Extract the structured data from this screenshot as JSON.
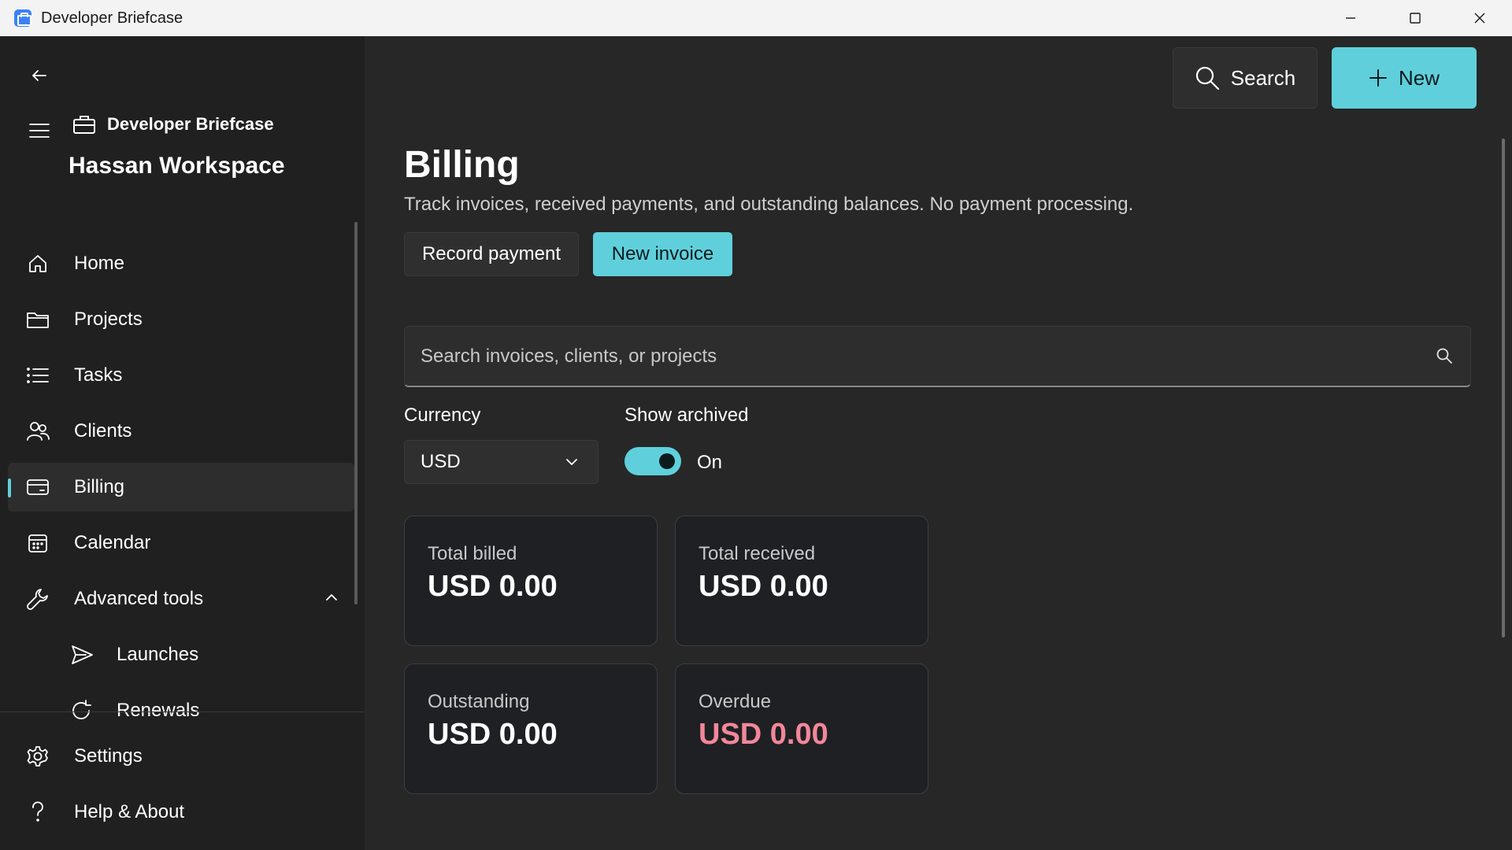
{
  "window": {
    "title": "Developer Briefcase",
    "controls": [
      "minimize-icon",
      "maximize-icon",
      "close-icon"
    ]
  },
  "sidebar": {
    "back_icon": "back-arrow-icon",
    "menu_icon": "hamburger-icon",
    "brand_label": "Developer Briefcase",
    "brand_icon": "briefcase-icon",
    "workspace": "Hassan Workspace",
    "items": [
      {
        "label": "Home",
        "icon": "home-icon"
      },
      {
        "label": "Projects",
        "icon": "folder-icon"
      },
      {
        "label": "Tasks",
        "icon": "list-icon"
      },
      {
        "label": "Clients",
        "icon": "people-icon"
      },
      {
        "label": "Billing",
        "icon": "card-icon",
        "active": true
      },
      {
        "label": "Calendar",
        "icon": "calendar-icon"
      },
      {
        "label": "Advanced tools",
        "icon": "wrench-icon",
        "expanded": true
      }
    ],
    "sub_items": [
      {
        "label": "Launches",
        "icon": "send-icon"
      },
      {
        "label": "Renewals",
        "icon": "refresh-icon"
      }
    ],
    "footer_items": [
      {
        "label": "Settings",
        "icon": "gear-icon"
      },
      {
        "label": "Help & About",
        "icon": "question-icon"
      }
    ]
  },
  "toolbar": {
    "search_label": "Search",
    "new_label": "New"
  },
  "page": {
    "title": "Billing",
    "subtitle": "Track invoices, received payments, and outstanding balances. No payment processing.",
    "record_payment_label": "Record payment",
    "new_invoice_label": "New invoice"
  },
  "search": {
    "placeholder": "Search invoices, clients, or projects"
  },
  "filters": {
    "currency_label": "Currency",
    "currency_value": "USD",
    "archived_label": "Show archived",
    "archived_state": "On"
  },
  "cards": [
    {
      "label": "Total billed",
      "value": "USD 0.00"
    },
    {
      "label": "Total received",
      "value": "USD 0.00"
    },
    {
      "label": "Outstanding",
      "value": "USD 0.00"
    },
    {
      "label": "Overdue",
      "value": "USD 0.00",
      "color": "#f2879a"
    }
  ],
  "colors": {
    "accent": "#5fd0db",
    "danger": "#f2879a",
    "sidebar_bg": "#202020",
    "main_bg": "#272727"
  }
}
